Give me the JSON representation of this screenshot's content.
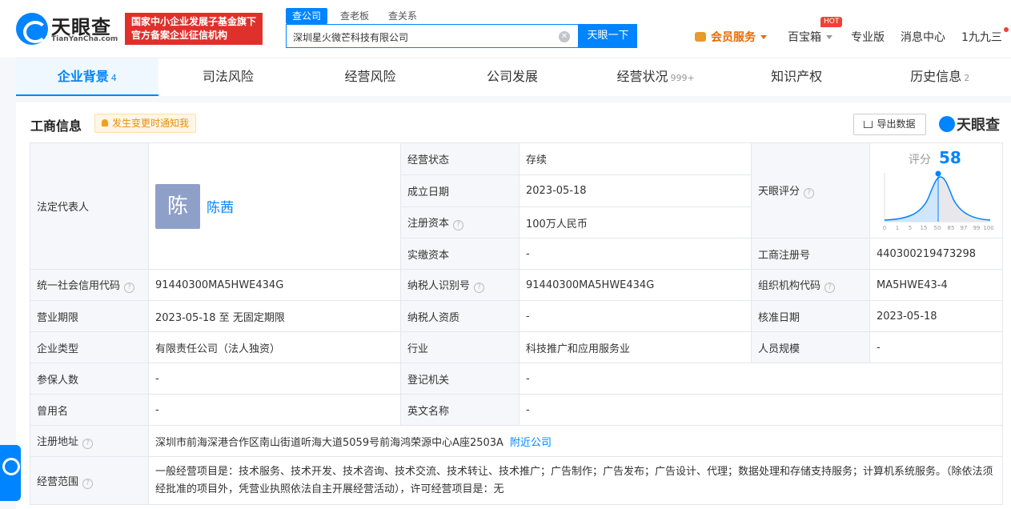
{
  "header": {
    "logo_name": "天眼查",
    "logo_domain": "TianYanCha.com",
    "gov_badge_line1": "国家中小企业发展子基金旗下",
    "gov_badge_line2": "官方备案企业征信机构",
    "search_tabs": [
      "查公司",
      "查老板",
      "查关系"
    ],
    "search_value": "深圳星火微芒科技有限公司",
    "search_button": "天眼一下",
    "nav": {
      "vip": "会员服务",
      "box": "百宝箱",
      "hot": "HOT",
      "pro": "专业版",
      "messages": "消息中心",
      "user": "1九九三"
    }
  },
  "tabs": [
    {
      "label": "企业背景",
      "count": "4"
    },
    {
      "label": "司法风险",
      "count": ""
    },
    {
      "label": "经营风险",
      "count": ""
    },
    {
      "label": "公司发展",
      "count": ""
    },
    {
      "label": "经营状况",
      "count": "999+"
    },
    {
      "label": "知识产权",
      "count": ""
    },
    {
      "label": "历史信息",
      "count": "2"
    }
  ],
  "section": {
    "title": "工商信息",
    "notify": "发生变更时通知我",
    "export": "导出数据",
    "brand": "天眼查"
  },
  "info": {
    "legal_rep_label": "法定代表人",
    "legal_rep_avatar": "陈",
    "legal_rep_name": "陈茜",
    "status_label": "经营状态",
    "status_value": "存续",
    "founded_label": "成立日期",
    "founded_value": "2023-05-18",
    "reg_capital_label": "注册资本",
    "reg_capital_value": "100万人民币",
    "paid_capital_label": "实缴资本",
    "paid_capital_value": "-",
    "score_label": "天眼评分",
    "score_title": "评分",
    "score_value": "58",
    "score_ticks": [
      "0",
      "1",
      "5",
      "15",
      "50",
      "85",
      "97",
      "99",
      "100"
    ],
    "reg_no_label": "工商注册号",
    "reg_no_value": "440300219473298",
    "credit_code_label": "统一社会信用代码",
    "credit_code_value": "91440300MA5HWE434G",
    "taxpayer_id_label": "纳税人识别号",
    "taxpayer_id_value": "91440300MA5HWE434G",
    "org_code_label": "组织机构代码",
    "org_code_value": "MA5HWE43-4",
    "term_label": "营业期限",
    "term_value": "2023-05-18 至 无固定期限",
    "taxpayer_qual_label": "纳税人资质",
    "taxpayer_qual_value": "-",
    "approved_label": "核准日期",
    "approved_value": "2023-05-18",
    "type_label": "企业类型",
    "type_value": "有限责任公司（法人独资）",
    "industry_label": "行业",
    "industry_value": "科技推广和应用服务业",
    "staff_label": "人员规模",
    "staff_value": "-",
    "insured_label": "参保人数",
    "insured_value": "-",
    "authority_label": "登记机关",
    "authority_value": "-",
    "former_name_label": "曾用名",
    "former_name_value": "-",
    "english_name_label": "英文名称",
    "english_name_value": "-",
    "address_label": "注册地址",
    "address_value": "深圳市前海深港合作区南山街道听海大道5059号前海鸿荣源中心A座2503A",
    "nearby_link": "附近公司",
    "scope_label": "经营范围",
    "scope_value": "一般经营项目是：技术服务、技术开发、技术咨询、技术交流、技术转让、技术推广；广告制作；广告发布；广告设计、代理；数据处理和存储支持服务；计算机系统服务。（除依法须经批准的项目外，凭营业执照依法自主开展经营活动），许可经营项目是：无"
  },
  "colors": {
    "accent": "#0084ff",
    "gov_red": "#e0302b",
    "vip": "#e86a00"
  }
}
